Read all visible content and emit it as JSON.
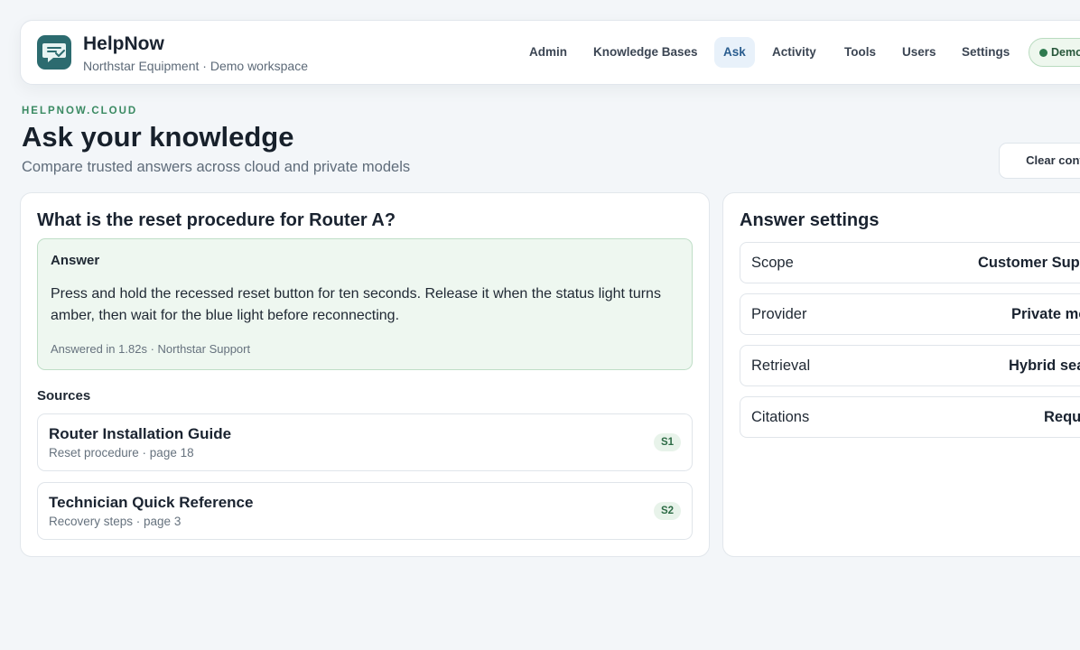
{
  "brand": {
    "name": "HelpNow",
    "subtitle": "Northstar Equipment · Demo workspace"
  },
  "nav": {
    "items": [
      {
        "label": "Admin",
        "active": false
      },
      {
        "label": "Knowledge Bases",
        "active": false
      },
      {
        "label": "Ask",
        "active": true
      },
      {
        "label": "Activity",
        "active": false
      },
      {
        "label": "Tools",
        "active": false
      },
      {
        "label": "Users",
        "active": false
      },
      {
        "label": "Settings",
        "active": false
      }
    ],
    "status_label": "Demo"
  },
  "hero": {
    "eyebrow": "HELPNOW.CLOUD",
    "title": "Ask your knowledge",
    "subtitle": "Compare trusted answers across cloud and private models",
    "clear_button": "Clear conve"
  },
  "question": {
    "title": "What is the reset procedure for Router A?",
    "answer_label": "Answer",
    "answer_text": "Press and hold the recessed reset button for ten seconds. Release it when the status light turns amber, then wait for the blue light before reconnecting.",
    "answer_meta": "Answered in 1.82s · Northstar Support",
    "sources_label": "Sources",
    "sources": [
      {
        "title": "Router Installation Guide",
        "subtitle": "Reset procedure · page 18",
        "badge": "S1"
      },
      {
        "title": "Technician Quick Reference",
        "subtitle": "Recovery steps · page 3",
        "badge": "S2"
      }
    ]
  },
  "settings": {
    "title": "Answer settings",
    "rows": [
      {
        "key": "Scope",
        "value": "Customer Supp"
      },
      {
        "key": "Provider",
        "value": "Private mo"
      },
      {
        "key": "Retrieval",
        "value": "Hybrid sea"
      },
      {
        "key": "Citations",
        "value": "Requ"
      }
    ]
  },
  "colors": {
    "accent": "#2a5d8f",
    "success": "#2f7a4f",
    "answer_bg": "#eef7f0",
    "logo": "#2c6b6f"
  }
}
